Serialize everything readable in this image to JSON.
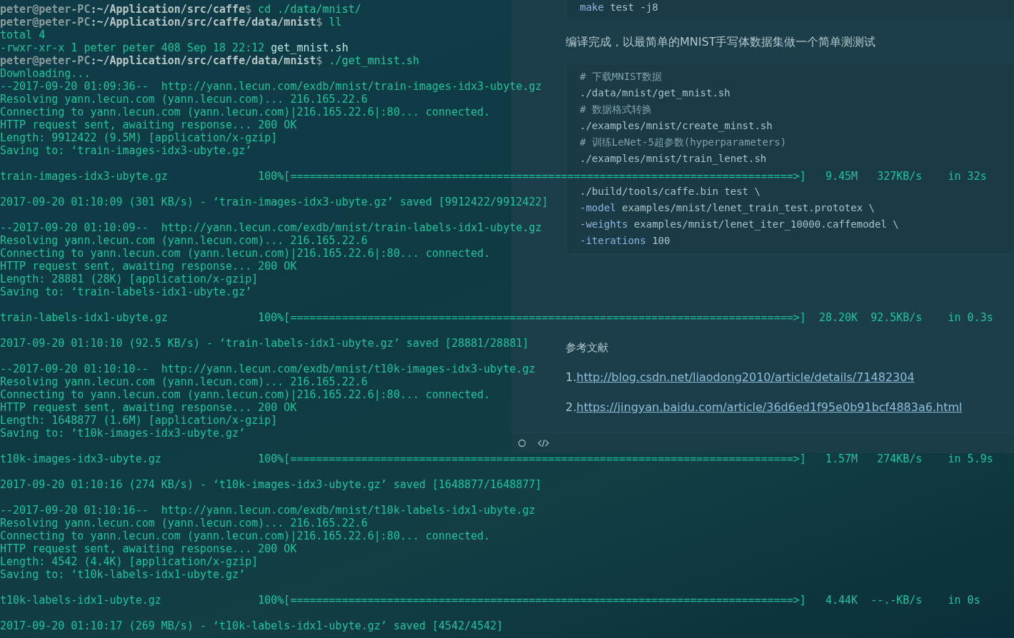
{
  "editor": {
    "blocks": [
      {
        "kind": "code",
        "lines": [
          {
            "kind": "keyword",
            "keyword": "make",
            "text": " test -j8"
          }
        ]
      },
      {
        "kind": "paragraph",
        "text": "编译完成，以最简单的MNIST手写体数据集做一个简单测测试"
      },
      {
        "kind": "code",
        "lines": [
          {
            "kind": "comment",
            "text": "# 下载MNIST数据"
          },
          {
            "kind": "plain",
            "text": "./data/mnist/get_mnist.sh"
          },
          {
            "kind": "comment",
            "text": "# 数据格式转换"
          },
          {
            "kind": "plain",
            "text": "./examples/mnist/create_minst.sh"
          },
          {
            "kind": "comment",
            "text": "# 训练LeNet-5超参数(hyperparameters)"
          },
          {
            "kind": "plain",
            "text": "./examples/mnist/train_lenet.sh"
          },
          {
            "kind": "gap"
          },
          {
            "kind": "plain",
            "text": "./build/tools/caffe.bin test \\"
          },
          {
            "kind": "keyword",
            "keyword": "-model",
            "text": " examples/mnist/lenet_train_test.prototex \\"
          },
          {
            "kind": "keyword",
            "keyword": "-weights",
            "text": " examples/mnist/lenet_iter_10000.caffemodel \\"
          },
          {
            "kind": "keyword",
            "keyword": "-iterations",
            "text": " 100"
          }
        ]
      },
      {
        "kind": "heading",
        "text": "参考文献"
      },
      {
        "kind": "reference",
        "number": "1.",
        "link": "http://blog.csdn.net/liaodong2010/article/details/71482304"
      },
      {
        "kind": "reference",
        "number": "2.",
        "link": "https://jingyan.baidu.com/article/36d6ed1f95e0b91bcf4883a6.html"
      }
    ]
  },
  "terminal": {
    "lines": [
      {
        "kind": "prompt",
        "host": "peter@peter-PC",
        "path": ":~/Application/src/caffe",
        "sign": "$",
        "command": " cd ./data/mnist/"
      },
      {
        "kind": "prompt",
        "host": "peter@peter-PC",
        "path": ":~/Application/src/caffe/data/mnist",
        "sign": "$",
        "command": " ll"
      },
      {
        "kind": "output",
        "text": "total 4"
      },
      {
        "kind": "listing",
        "text": "-rwxr-xr-x 1 peter peter 408 Sep 18 22:12 ",
        "file": "get_mnist.sh"
      },
      {
        "kind": "prompt",
        "host": "peter@peter-PC",
        "path": ":~/Application/src/caffe/data/mnist",
        "sign": "$",
        "command": " ./get_mnist.sh"
      },
      {
        "kind": "output",
        "text": "Downloading..."
      },
      {
        "kind": "output",
        "text": "--2017-09-20 01:09:36--  http://yann.lecun.com/exdb/mnist/train-images-idx3-ubyte.gz"
      },
      {
        "kind": "output",
        "text": "Resolving yann.lecun.com (yann.lecun.com)... 216.165.22.6"
      },
      {
        "kind": "output",
        "text": "Connecting to yann.lecun.com (yann.lecun.com)|216.165.22.6|:80... connected."
      },
      {
        "kind": "output",
        "text": "HTTP request sent, awaiting response... 200 OK"
      },
      {
        "kind": "output",
        "text": "Length: 9912422 (9.5M) [application/x-gzip]"
      },
      {
        "kind": "output",
        "text": "Saving to: ‘train-images-idx3-ubyte.gz’"
      },
      {
        "kind": "blank"
      },
      {
        "kind": "output",
        "text": "train-images-idx3-ubyte.gz              100%[==============================================================================>]   9.45M   327KB/s    in 32s"
      },
      {
        "kind": "blank"
      },
      {
        "kind": "output",
        "text": "2017-09-20 01:10:09 (301 KB/s) - ‘train-images-idx3-ubyte.gz’ saved [9912422/9912422]"
      },
      {
        "kind": "blank"
      },
      {
        "kind": "output",
        "text": "--2017-09-20 01:10:09--  http://yann.lecun.com/exdb/mnist/train-labels-idx1-ubyte.gz"
      },
      {
        "kind": "output",
        "text": "Resolving yann.lecun.com (yann.lecun.com)... 216.165.22.6"
      },
      {
        "kind": "output",
        "text": "Connecting to yann.lecun.com (yann.lecun.com)|216.165.22.6|:80... connected."
      },
      {
        "kind": "output",
        "text": "HTTP request sent, awaiting response... 200 OK"
      },
      {
        "kind": "output",
        "text": "Length: 28881 (28K) [application/x-gzip]"
      },
      {
        "kind": "output",
        "text": "Saving to: ‘train-labels-idx1-ubyte.gz’"
      },
      {
        "kind": "blank"
      },
      {
        "kind": "output",
        "text": "train-labels-idx1-ubyte.gz              100%[==============================================================================>]  28.20K  92.5KB/s    in 0.3s"
      },
      {
        "kind": "blank"
      },
      {
        "kind": "output",
        "text": "2017-09-20 01:10:10 (92.5 KB/s) - ‘train-labels-idx1-ubyte.gz’ saved [28881/28881]"
      },
      {
        "kind": "blank"
      },
      {
        "kind": "output",
        "text": "--2017-09-20 01:10:10--  http://yann.lecun.com/exdb/mnist/t10k-images-idx3-ubyte.gz"
      },
      {
        "kind": "output",
        "text": "Resolving yann.lecun.com (yann.lecun.com)... 216.165.22.6"
      },
      {
        "kind": "output",
        "text": "Connecting to yann.lecun.com (yann.lecun.com)|216.165.22.6|:80... connected."
      },
      {
        "kind": "output",
        "text": "HTTP request sent, awaiting response... 200 OK"
      },
      {
        "kind": "output",
        "text": "Length: 1648877 (1.6M) [application/x-gzip]"
      },
      {
        "kind": "output",
        "text": "Saving to: ‘t10k-images-idx3-ubyte.gz’"
      },
      {
        "kind": "blank"
      },
      {
        "kind": "output",
        "text": "t10k-images-idx3-ubyte.gz               100%[==============================================================================>]   1.57M   274KB/s    in 5.9s"
      },
      {
        "kind": "blank"
      },
      {
        "kind": "output",
        "text": "2017-09-20 01:10:16 (274 KB/s) - ‘t10k-images-idx3-ubyte.gz’ saved [1648877/1648877]"
      },
      {
        "kind": "blank"
      },
      {
        "kind": "output",
        "text": "--2017-09-20 01:10:16--  http://yann.lecun.com/exdb/mnist/t10k-labels-idx1-ubyte.gz"
      },
      {
        "kind": "output",
        "text": "Resolving yann.lecun.com (yann.lecun.com)... 216.165.22.6"
      },
      {
        "kind": "output",
        "text": "Connecting to yann.lecun.com (yann.lecun.com)|216.165.22.6|:80... connected."
      },
      {
        "kind": "output",
        "text": "HTTP request sent, awaiting response... 200 OK"
      },
      {
        "kind": "output",
        "text": "Length: 4542 (4.4K) [application/x-gzip]"
      },
      {
        "kind": "output",
        "text": "Saving to: ‘t10k-labels-idx1-ubyte.gz’"
      },
      {
        "kind": "blank"
      },
      {
        "kind": "output",
        "text": "t10k-labels-idx1-ubyte.gz               100%[==============================================================================>]   4.44K  --.-KB/s    in 0s"
      },
      {
        "kind": "blank"
      },
      {
        "kind": "output",
        "text": "2017-09-20 01:10:17 (269 MB/s) - ‘t10k-labels-idx1-ubyte.gz’ saved [4542/4542]"
      }
    ]
  }
}
